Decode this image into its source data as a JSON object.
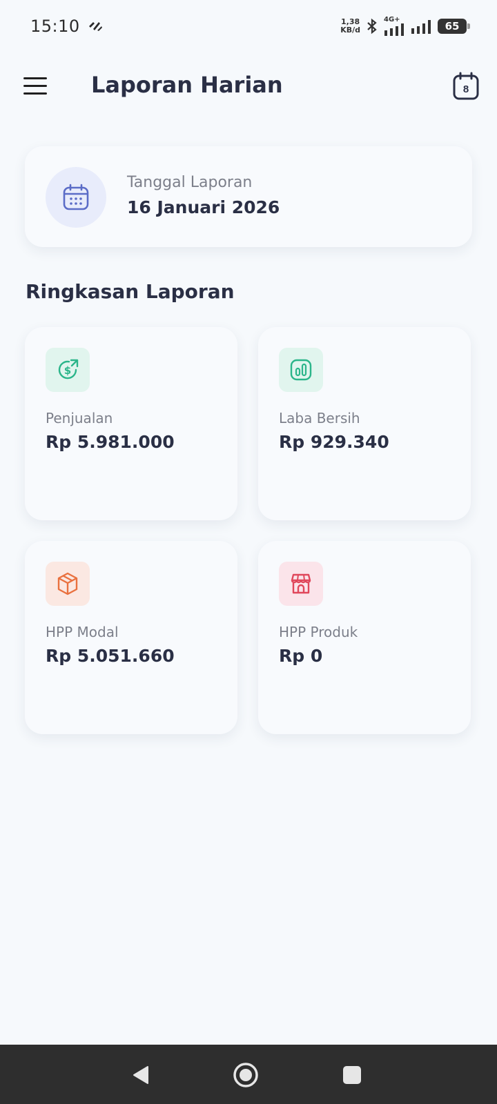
{
  "status_bar": {
    "time": "15:10",
    "net_speed_value": "1,38",
    "net_speed_unit": "KB/d",
    "network_type": "4G+",
    "battery": "65"
  },
  "app_bar": {
    "title": "Laporan Harian",
    "calendar_day": "8"
  },
  "date_card": {
    "label": "Tanggal Laporan",
    "value": "16 Januari 2026"
  },
  "summary": {
    "title": "Ringkasan Laporan",
    "cards": [
      {
        "label": "Penjualan",
        "value": "Rp 5.981.000",
        "icon": "sales-dollar-icon",
        "color": "#2BB58A",
        "bg": "#E1F5EE"
      },
      {
        "label": "Laba Bersih",
        "value": "Rp 929.340",
        "icon": "chart-bars-icon",
        "color": "#2BB58A",
        "bg": "#E1F5EE"
      },
      {
        "label": "HPP Modal",
        "value": "Rp 5.051.660",
        "icon": "package-box-icon",
        "color": "#E9713F",
        "bg": "#FBE8E2"
      },
      {
        "label": "HPP Produk",
        "value": "Rp 0",
        "icon": "store-icon",
        "color": "#E0475B",
        "bg": "#FBE4EA"
      }
    ]
  },
  "colors": {
    "background": "#F6F9FC",
    "text_primary": "#2A2F45",
    "text_secondary": "#7C7F8A",
    "date_icon": "#5B6CC7",
    "date_icon_bg": "#E8ECFB",
    "nav_bar": "#2E2E2E"
  }
}
